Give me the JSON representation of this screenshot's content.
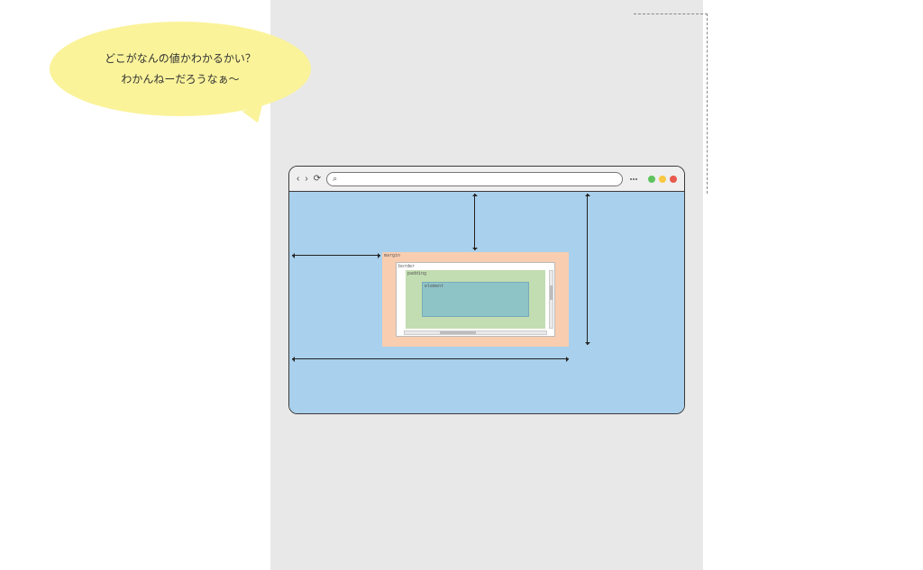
{
  "bubble": {
    "line1": "どこがなんの値かわかるかい？",
    "line2": "わかんねーだろうなぁ〜"
  },
  "browser": {
    "back": "‹",
    "forward": "›",
    "reload": "⟳",
    "search_icon": "⌕",
    "address": ""
  },
  "box_model": {
    "margin": "margin",
    "border": "border",
    "padding": "padding",
    "element": "element"
  },
  "colors": {
    "bubble": "#faf39a",
    "slide_bg": "#e8e8e8",
    "viewport": "#a9d0ec",
    "margin": "#f8cdb0",
    "border": "#ffffff",
    "padding": "#c1ddb1",
    "element": "#8fc4c7"
  }
}
